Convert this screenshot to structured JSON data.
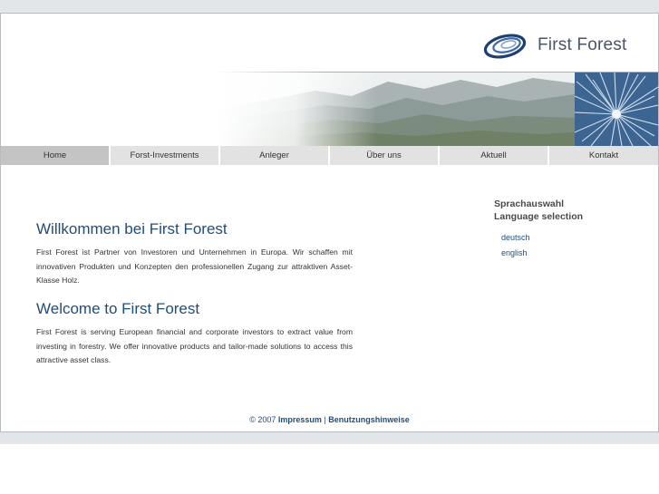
{
  "brand": {
    "name": "First Forest"
  },
  "nav": {
    "items": [
      "Home",
      "Forst-Investments",
      "Anleger",
      "Über uns",
      "Aktuell",
      "Kontakt"
    ],
    "active": "Home"
  },
  "main": {
    "de_title": "Willkommen bei First Forest",
    "de_text": "First Forest ist Partner von Investoren und Unternehmen in Europa. Wir schaffen mit innovativen Produkten und Konzepten den professionellen Zugang zur attraktiven Asset-Klasse Holz.",
    "en_title": "Welcome to First Forest",
    "en_text": "First Forest is serving European financial and corporate investors to extract value from investing in forestry. We offer innovative products and tailor-made solutions to access this attractive asset class."
  },
  "language": {
    "heading_de": "Sprachauswahl",
    "heading_en": "Language selection",
    "options": [
      "deutsch",
      "english"
    ]
  },
  "footer": {
    "copyright": "© 2007",
    "impressum": "Impressum",
    "separator": "|",
    "terms": "Benutzungshinweise"
  },
  "colors": {
    "accent": "#1f4e79",
    "nav_bg": "#e2e2e2",
    "nav_active_bg": "#c4c4c4",
    "page_strip": "#e3e6e9"
  },
  "icons": {
    "logo": "first-forest-swirl-logo"
  }
}
